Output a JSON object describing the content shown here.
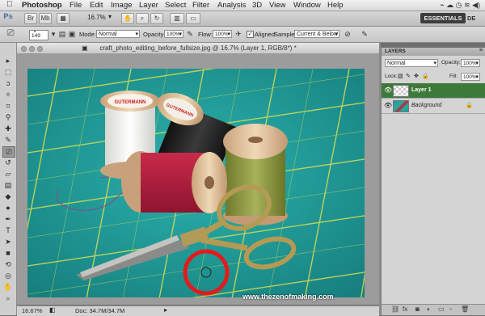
{
  "menubar": {
    "apple": "",
    "app_name": "Photoshop",
    "items": [
      "File",
      "Edit",
      "Image",
      "Layer",
      "Select",
      "Filter",
      "Analysis",
      "3D",
      "View",
      "Window",
      "Help"
    ],
    "tray": "⌁ ☁ ◷ ≋ ◀)"
  },
  "appbar": {
    "logo": "Ps",
    "zoom": "16.7%",
    "workspace": "ESSENTIALS",
    "workspace_next": "DE"
  },
  "options": {
    "brush_size": "149",
    "mode_label": "Mode:",
    "mode_value": "Normal",
    "opacity_label": "Opacity:",
    "opacity_value": "100%",
    "flow_label": "Flow:",
    "flow_value": "100%",
    "aligned_label": "Aligned",
    "sample_label": "Sample:",
    "sample_value": "Current & Below"
  },
  "document": {
    "title": "craft_photo_editing_before_fullsize.jpg @ 16.7% (Layer 1, RGB/8*) *",
    "zoom": "16.67%",
    "doc_size": "Doc: 34.7M/34.7M",
    "watermark": "www.thezenofmaking.com",
    "spool_label_1": "GUTERMANN",
    "spool_label_2": "GUTERMANN"
  },
  "layers_panel": {
    "tab": "LAYERS",
    "blend_mode": "Normal",
    "opacity_label": "Opacity:",
    "opacity_value": "100%",
    "lock_label": "Lock:",
    "fill_label": "Fill:",
    "fill_value": "100%",
    "layers": [
      {
        "name": "Layer 1",
        "selected": true
      },
      {
        "name": "Background",
        "selected": false
      }
    ]
  },
  "colors": {
    "mat_teal": "#1f9a98",
    "grid_yellow": "#d9e05a",
    "selected_layer": "#3d7a3a",
    "red_ring": "#e21b1b"
  }
}
